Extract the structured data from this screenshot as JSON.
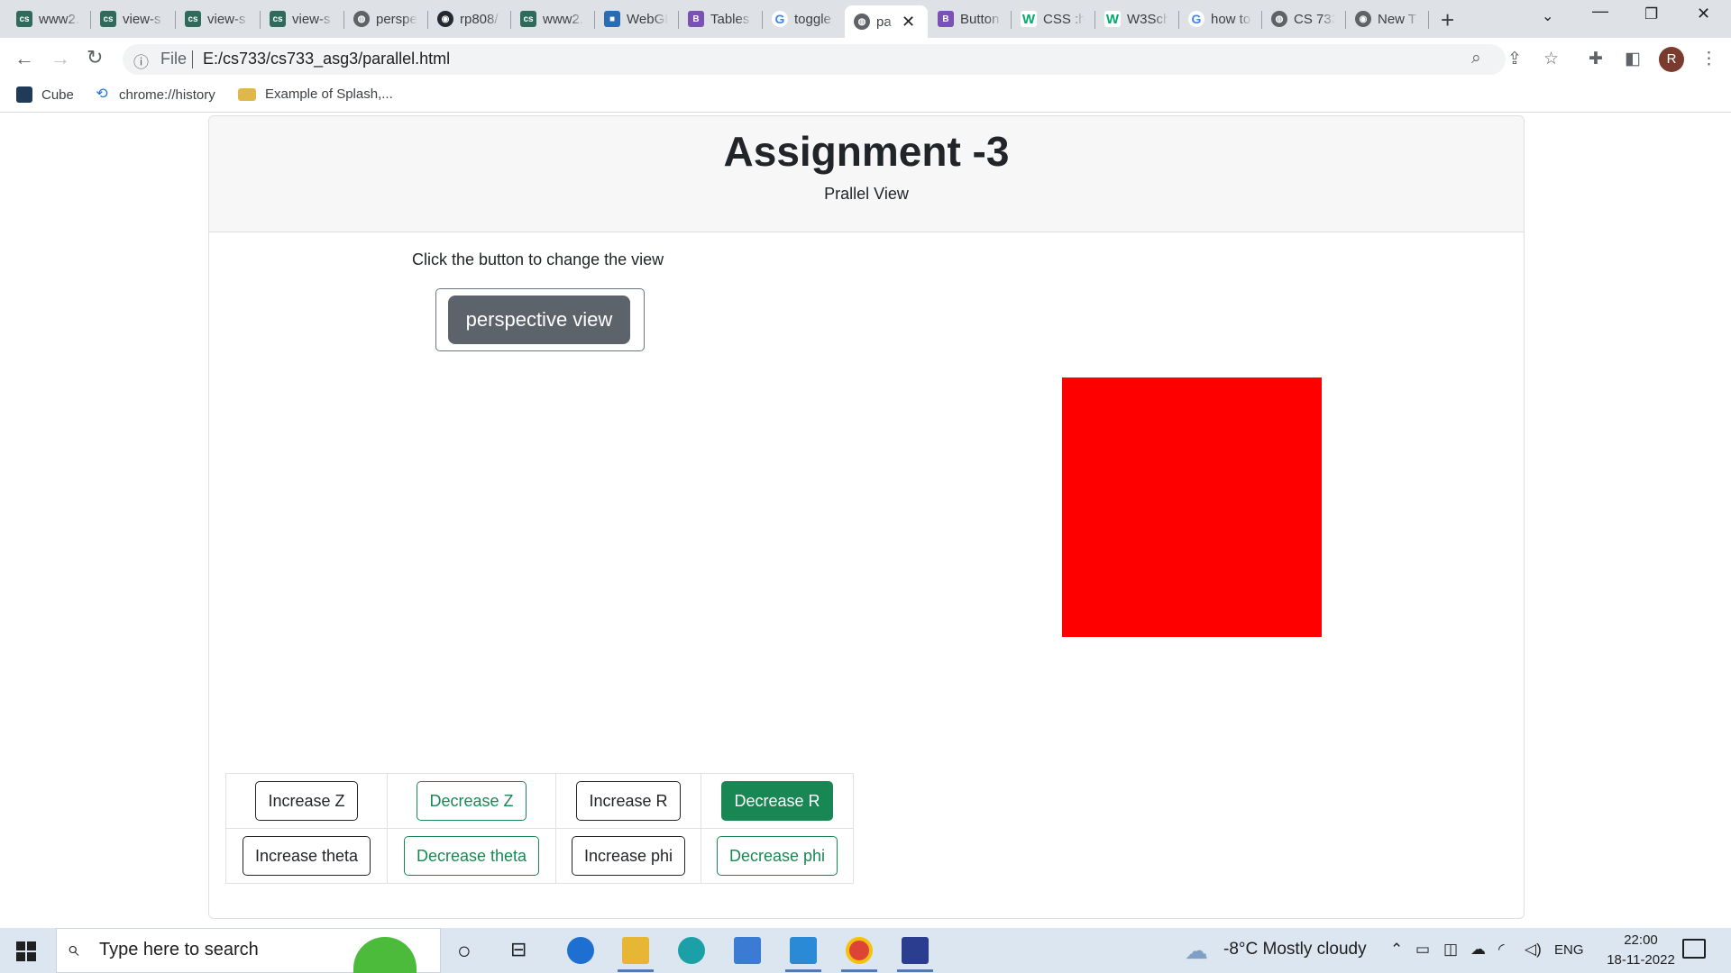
{
  "browser": {
    "tabs": [
      {
        "label": "www2.",
        "favicon": "cs-icon"
      },
      {
        "label": "view-s",
        "favicon": "cs-icon"
      },
      {
        "label": "view-s",
        "favicon": "cs-icon"
      },
      {
        "label": "view-s",
        "favicon": "cs-icon"
      },
      {
        "label": "perspe",
        "favicon": "globe-icon"
      },
      {
        "label": "rp808/",
        "favicon": "github-icon"
      },
      {
        "label": "www2.",
        "favicon": "cs-icon"
      },
      {
        "label": "WebGL",
        "favicon": "cube-icon"
      },
      {
        "label": "Tables",
        "favicon": "bootstrap-icon"
      },
      {
        "label": "toggle",
        "favicon": "google-icon"
      },
      {
        "label": "pa",
        "favicon": "globe-icon",
        "active": true
      },
      {
        "label": "Button",
        "favicon": "bootstrap-icon"
      },
      {
        "label": "CSS :h",
        "favicon": "w3schools-icon"
      },
      {
        "label": "W3Sch",
        "favicon": "w3schools-icon"
      },
      {
        "label": "how to",
        "favicon": "google-icon"
      },
      {
        "label": "CS 733",
        "favicon": "globe-icon"
      },
      {
        "label": "New T",
        "favicon": "chrome-icon"
      }
    ],
    "address": {
      "scheme_label": "File",
      "url": "E:/cs733/cs733_asg3/parallel.html"
    },
    "profile_initial": "R",
    "bookmarks": [
      {
        "label": "Cube"
      },
      {
        "label": "chrome://history"
      },
      {
        "label": "Example of Splash,..."
      }
    ]
  },
  "page": {
    "title": "Assignment -3",
    "subtitle": "Prallel View",
    "instruction": "Click the button to change the view",
    "toggle_button": "perspective view",
    "square_color": "#ff0000",
    "controls": {
      "row1": [
        "Increase Z",
        "Decrease Z",
        "Increase R",
        "Decrease R"
      ],
      "row2": [
        "Increase theta",
        "Decrease theta",
        "Increase phi",
        "Decrease phi"
      ]
    }
  },
  "taskbar": {
    "search_placeholder": "Type here to search",
    "weather": "-8°C  Mostly cloudy",
    "language": "ENG",
    "time": "22:00",
    "date": "18-11-2022"
  }
}
